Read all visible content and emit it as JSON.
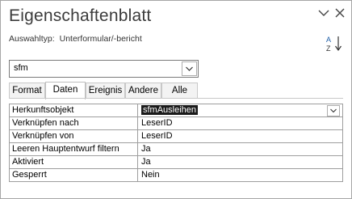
{
  "window": {
    "title": "Eigenschaftenblatt"
  },
  "selection": {
    "label": "Auswahltyp:",
    "value": "Unterformular/-bericht"
  },
  "icons": {
    "collapse": "chevron-down-icon",
    "close": "close-icon",
    "sort": "sort-az-icon",
    "dropdown": "chevron-down-icon"
  },
  "object_combo": {
    "value": "sfm"
  },
  "tabs": [
    {
      "label": "Format",
      "active": false
    },
    {
      "label": "Daten",
      "active": true
    },
    {
      "label": "Ereignis",
      "active": false
    },
    {
      "label": "Andere",
      "active": false
    },
    {
      "label": "Alle",
      "active": false
    }
  ],
  "properties": [
    {
      "name": "Herkunftsobjekt",
      "value": "sfmAusleihen",
      "selected": true,
      "dropdown": true
    },
    {
      "name": "Verknüpfen nach",
      "value": "LeserID"
    },
    {
      "name": "Verknüpfen von",
      "value": "LeserID"
    },
    {
      "name": "Leeren Hauptentwurf filtern",
      "value": "Ja"
    },
    {
      "name": "Aktiviert",
      "value": "Ja"
    },
    {
      "name": "Gesperrt",
      "value": "Nein"
    }
  ],
  "colors": {
    "border": "#9e9e9e",
    "selection_bg": "#1a1a1a",
    "title_text": "#3b3b3b"
  }
}
